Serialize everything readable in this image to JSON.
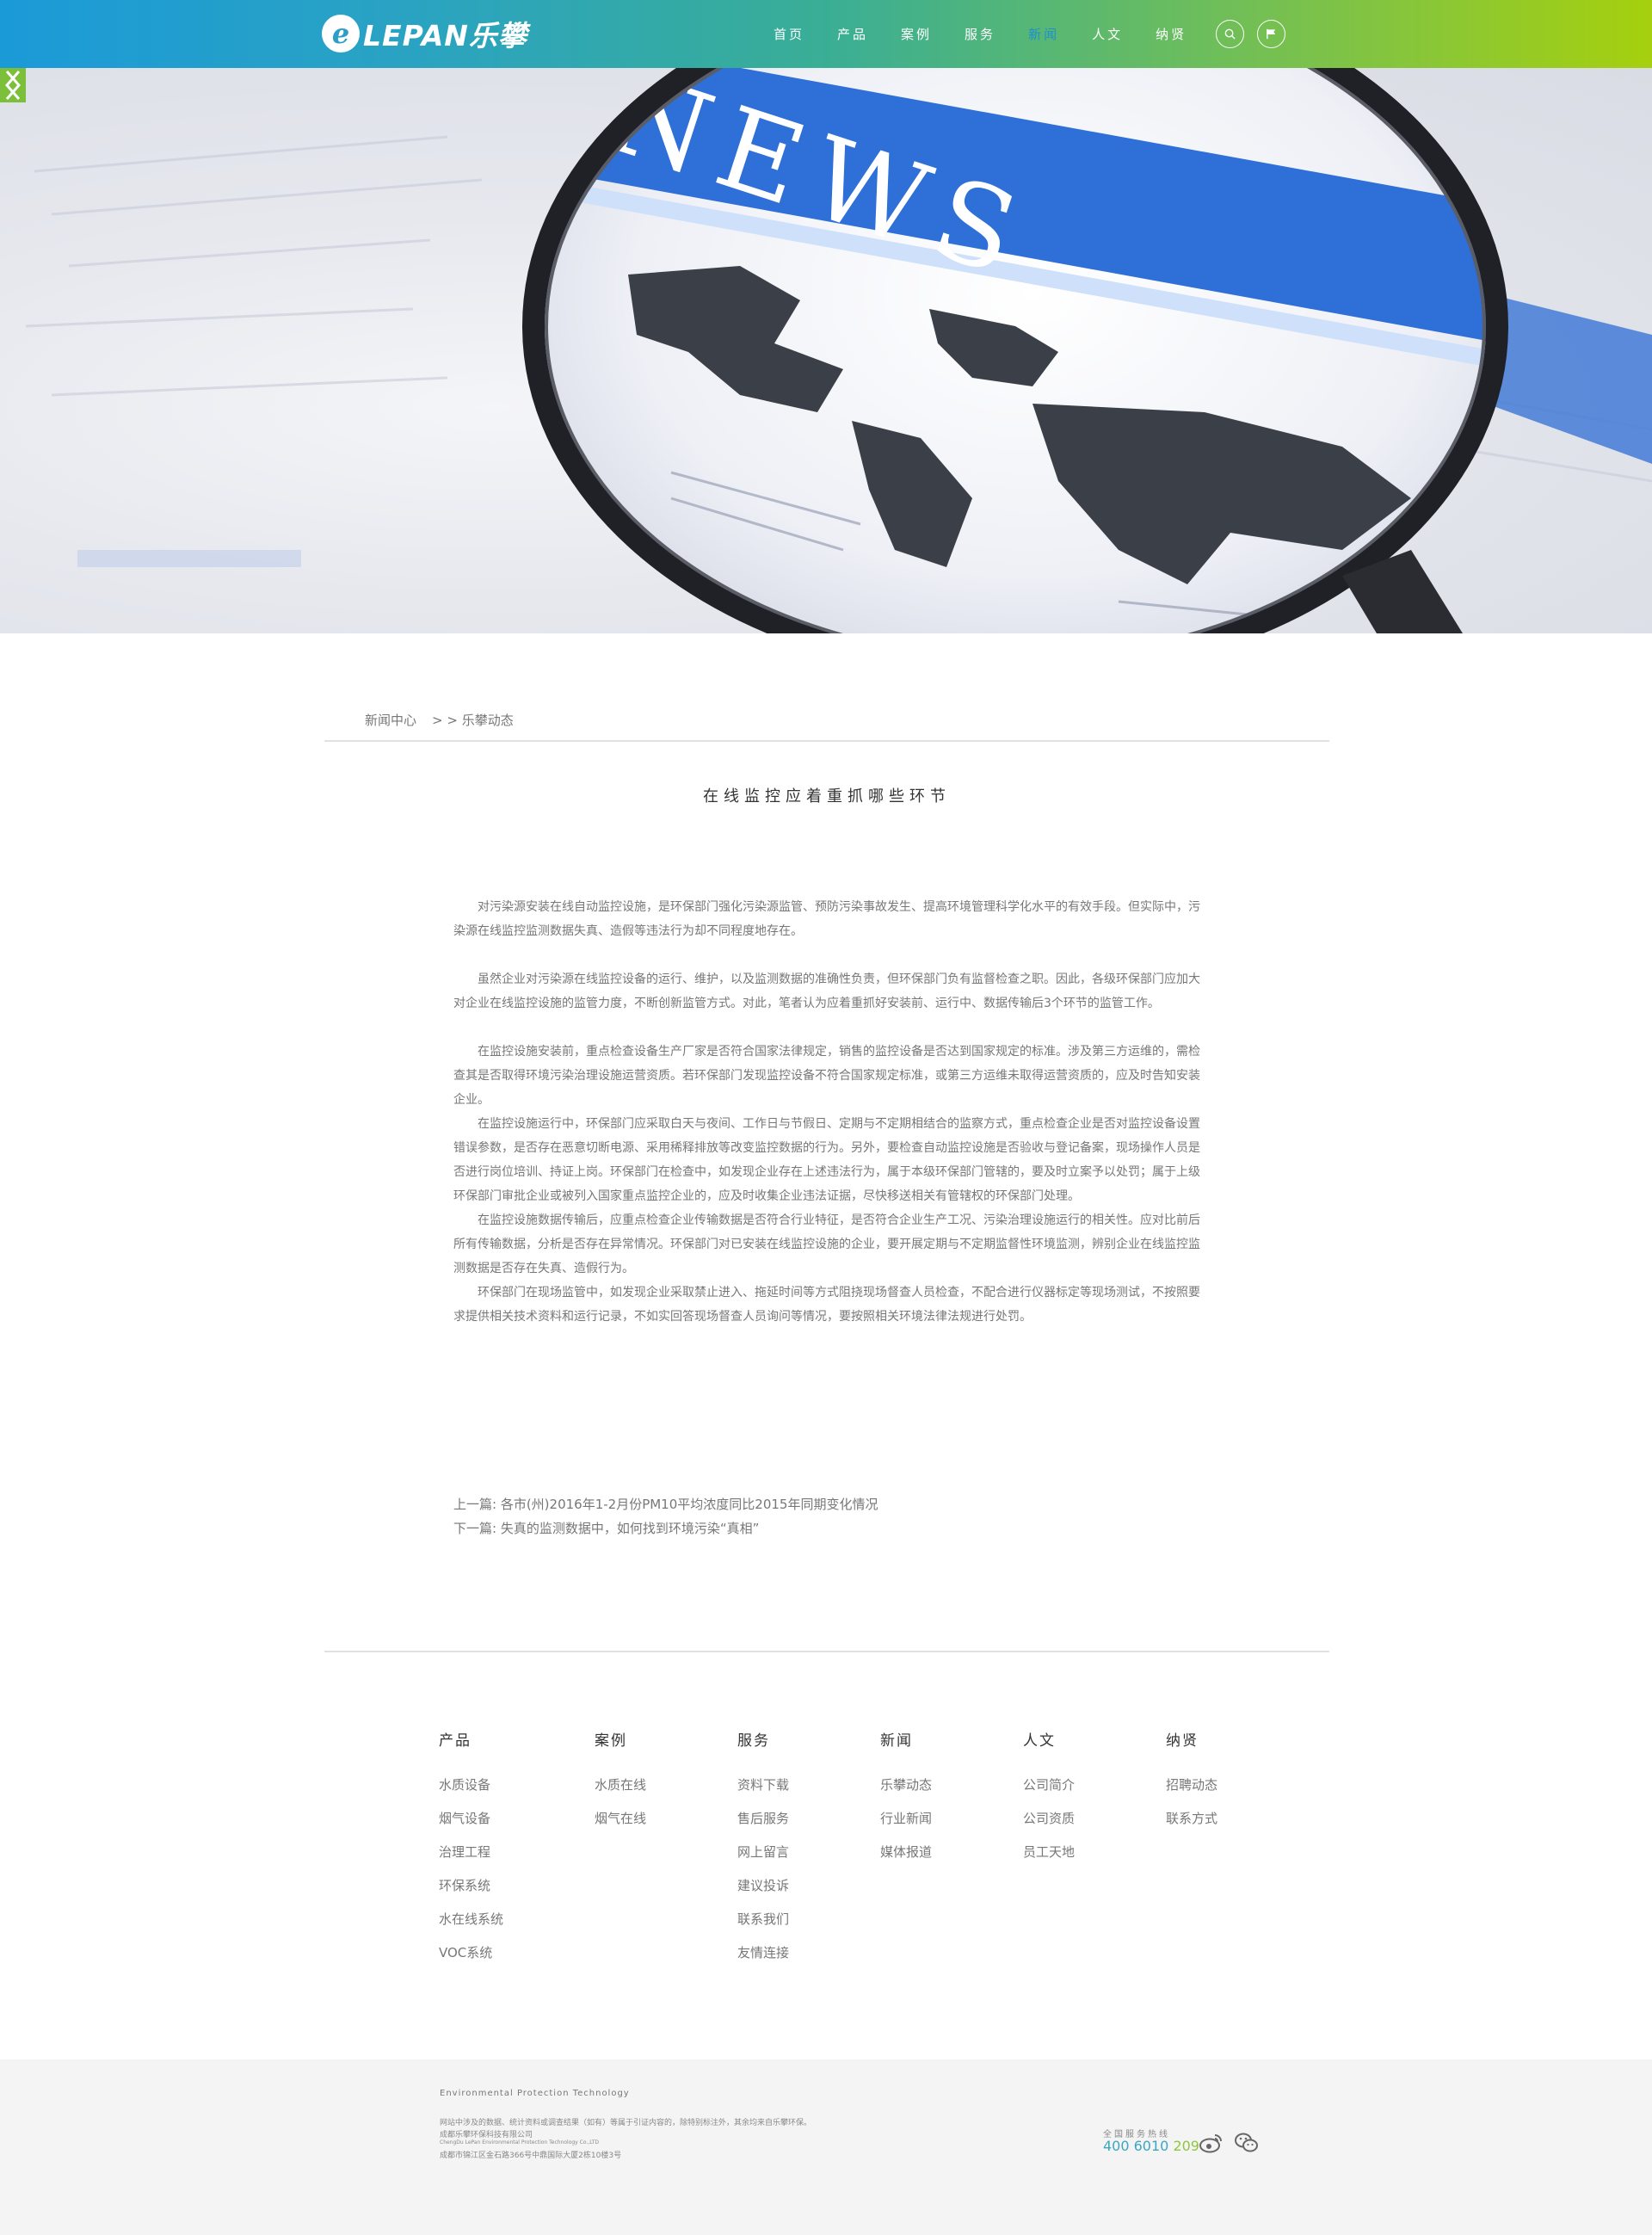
{
  "header": {
    "logo_text": "LEPAN乐攀",
    "nav": [
      "首页",
      "产品",
      "案例",
      "服务",
      "新闻",
      "人文",
      "纳贤"
    ],
    "active_nav": "新闻",
    "search_icon": "search-icon",
    "flag_icon": "flag-icon"
  },
  "banner": {
    "headline": "NEWS",
    "prev_icon": "chevron-left-icon",
    "next_icon": "chevron-right-icon"
  },
  "breadcrumb": {
    "root": "新闻中心",
    "current": "> > 乐攀动态"
  },
  "article": {
    "title": "在线监控应着重抓哪些环节",
    "paragraphs": [
      "对污染源安装在线自动监控设施，是环保部门强化污染源监管、预防污染事故发生、提高环境管理科学化水平的有效手段。但实际中，污染源在线监控监测数据失真、造假等违法行为却不同程度地存在。",
      "虽然企业对污染源在线监控设备的运行、维护，以及监测数据的准确性负责，但环保部门负有监督检查之职。因此，各级环保部门应加大对企业在线监控设施的监管力度，不断创新监管方式。对此，笔者认为应着重抓好安装前、运行中、数据传输后3个环节的监管工作。",
      "在监控设施安装前，重点检查设备生产厂家是否符合国家法律规定，销售的监控设备是否达到国家规定的标准。涉及第三方运维的，需检查其是否取得环境污染治理设施运营资质。若环保部门发现监控设备不符合国家规定标准，或第三方运维未取得运营资质的，应及时告知安装企业。",
      "在监控设施运行中，环保部门应采取白天与夜间、工作日与节假日、定期与不定期相结合的监察方式，重点检查企业是否对监控设备设置错误参数，是否存在恶意切断电源、采用稀释排放等改变监控数据的行为。另外，要检查自动监控设施是否验收与登记备案，现场操作人员是否进行岗位培训、持证上岗。环保部门在检查中，如发现企业存在上述违法行为，属于本级环保部门管辖的，要及时立案予以处罚；属于上级环保部门审批企业或被列入国家重点监控企业的，应及时收集企业违法证据，尽快移送相关有管辖权的环保部门处理。",
      "在监控设施数据传输后，应重点检查企业传输数据是否符合行业特征，是否符合企业生产工况、污染治理设施运行的相关性。应对比前后所有传输数据，分析是否存在异常情况。环保部门对已安装在线监控设施的企业，要开展定期与不定期监督性环境监测，辨别企业在线监控监测数据是否存在失真、造假行为。",
      "环保部门在现场监管中，如发现企业采取禁止进入、拖延时间等方式阻挠现场督查人员检查，不配合进行仪器标定等现场测试，不按照要求提供相关技术资料和运行记录，不如实回答现场督查人员询问等情况，要按照相关环境法律法规进行处罚。"
    ],
    "prev": "上一篇: 各市(州)2016年1-2月份PM10平均浓度同比2015年同期变化情况",
    "next": "下一篇: 失真的监测数据中，如何找到环境污染“真相”"
  },
  "footer_nav": [
    {
      "title": "产品",
      "items": [
        "水质设备",
        "烟气设备",
        "治理工程",
        "环保系统",
        "水在线系统",
        "VOC系统"
      ]
    },
    {
      "title": "案例",
      "items": [
        "水质在线",
        "烟气在线"
      ]
    },
    {
      "title": "服务",
      "items": [
        "资料下载",
        "售后服务",
        "网上留言",
        "建议投诉",
        "联系我们",
        "友情连接"
      ]
    },
    {
      "title": "新闻",
      "items": [
        "乐攀动态",
        "行业新闻",
        "媒体报道"
      ]
    },
    {
      "title": "人文",
      "items": [
        "公司简介",
        "公司资质",
        "员工天地"
      ]
    },
    {
      "title": "纳贤",
      "items": [
        "招聘动态",
        "联系方式"
      ]
    }
  ],
  "bottom": {
    "tagline": "Environmental  Protection  Technology",
    "lines": [
      "网站中涉及的数据、统计资料或调查结果（如有）等属于引证内容的，除特别标注外，其余均来自乐攀环保。",
      "成都乐攀环保科技有限公司",
      "ChengDu LePan Environmental Protection Technology Co.,LTD",
      "成都市锦江区金石路366号中鼎国际大厦2栋10楼3号"
    ],
    "hotline_label": "全国服务热线",
    "hotline_part1": "400 6010 ",
    "hotline_part2": "209",
    "weibo_icon": "weibo-icon",
    "wechat_icon": "wechat-icon"
  }
}
